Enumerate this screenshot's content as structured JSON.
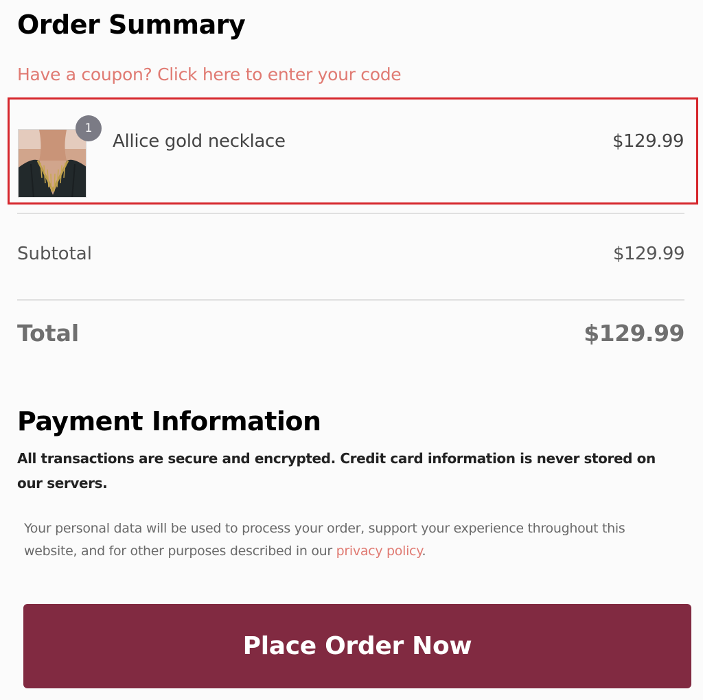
{
  "order_summary": {
    "title": "Order Summary",
    "coupon_link": "Have a coupon? Click here to enter your code",
    "item": {
      "quantity": "1",
      "name": "Allice gold necklace",
      "price": "$129.99",
      "thumbnail": "necklace-product-image"
    },
    "subtotal_label": "Subtotal",
    "subtotal_value": "$129.99",
    "total_label": "Total",
    "total_value": "$129.99"
  },
  "payment": {
    "title": "Payment Information",
    "secure_text": "All transactions are secure and encrypted. Credit card information is never stored on our servers.",
    "privacy_text_before": "Your personal data will be used to process your order, support your experience throughout this website, and for other purposes described in our ",
    "privacy_link": "privacy policy",
    "privacy_text_after": "."
  },
  "actions": {
    "place_order_label": "Place Order Now"
  },
  "colors": {
    "accent_link": "#e07a72",
    "highlight_border": "#d6262c",
    "button_bg": "#812a41",
    "badge_bg": "#7b7b85"
  }
}
